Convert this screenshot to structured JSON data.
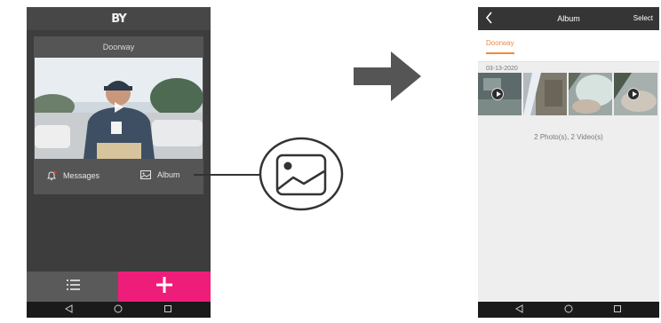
{
  "left_phone": {
    "logo": "BY",
    "camera_card": {
      "title": "Doorway"
    },
    "actions": {
      "messages_label": "Messages",
      "album_label": "Album"
    },
    "icons": [
      "bell-icon",
      "album-icon",
      "play-icon",
      "list-icon",
      "plus-icon"
    ],
    "accent_color": "#ee1d79",
    "notification_dot_color": "#e03030"
  },
  "right_phone": {
    "header": {
      "title": "Album",
      "select_label": "Select"
    },
    "tab": {
      "label": "Doorway"
    },
    "date_label": "03-13-2020",
    "summary": "2 Photo(s), 2 Video(s)",
    "tab_color": "#f08a3c"
  },
  "nav_icons": [
    "back-triangle-icon",
    "home-circle-icon",
    "recents-square-icon"
  ]
}
